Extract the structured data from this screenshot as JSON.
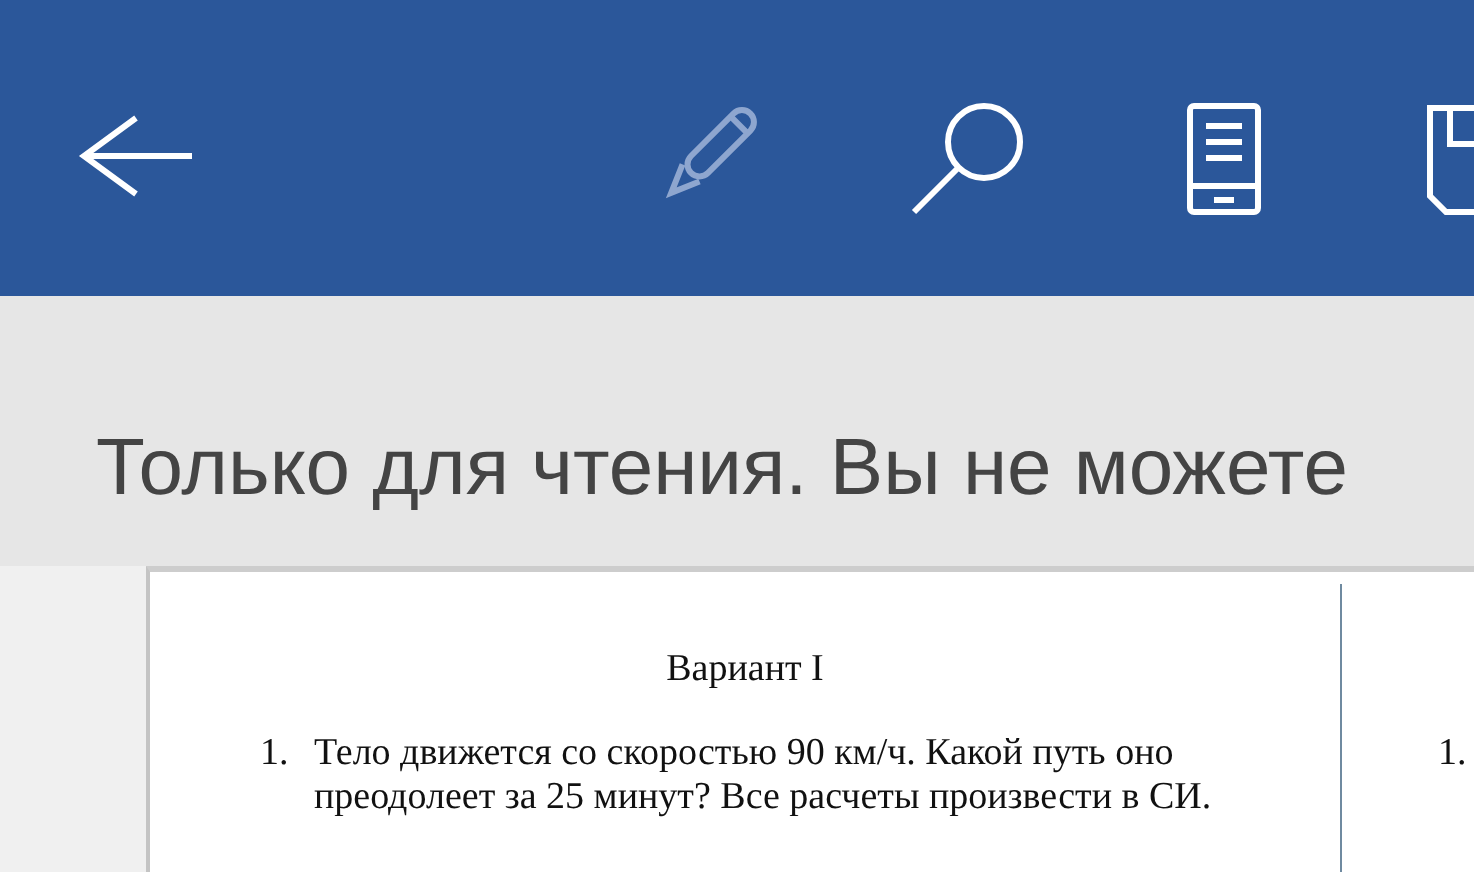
{
  "toolbar": {
    "buttons": [
      {
        "kind": "back",
        "disabled": false
      },
      {
        "kind": "edit",
        "disabled": true
      },
      {
        "kind": "search",
        "disabled": false
      },
      {
        "kind": "reading-view",
        "disabled": false
      },
      {
        "kind": "save",
        "disabled": false
      }
    ]
  },
  "banner": {
    "text": "Только для чтения. Вы не можете"
  },
  "document": {
    "columns": [
      {
        "heading": "Вариант I",
        "items": [
          {
            "number": "1.",
            "text": "Тело движется со скоростью 90 км/ч. Какой путь оно преодолеет за 25 минут? Все расчеты произвести в СИ."
          }
        ]
      },
      {
        "items": [
          {
            "number": "1."
          }
        ]
      }
    ]
  }
}
